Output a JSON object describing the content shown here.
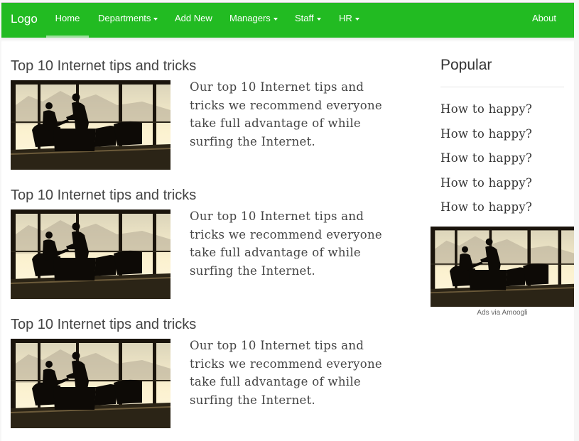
{
  "navbar": {
    "logo": "Logo",
    "items": [
      {
        "label": "Home"
      },
      {
        "label": "Departments"
      },
      {
        "label": "Add New"
      },
      {
        "label": "Managers"
      },
      {
        "label": "Staff"
      },
      {
        "label": "HR"
      }
    ],
    "about": "About",
    "color": "#22bb22"
  },
  "posts": [
    {
      "title": "Top 10 Internet tips and tricks",
      "excerpt": "Our top 10 Internet tips and tricks we recommend everyone take full advantage of while surfing the Internet."
    },
    {
      "title": "Top 10 Internet tips and tricks",
      "excerpt": "Our top 10 Internet tips and tricks we recommend everyone take full advantage of while surfing the Internet."
    },
    {
      "title": "Top 10 Internet tips and tricks",
      "excerpt": "Our top 10 Internet tips and tricks we recommend everyone take full advantage of while surfing the Internet."
    }
  ],
  "sidebar": {
    "heading": "Popular",
    "links": [
      "How to happy?",
      "How to happy?",
      "How to happy?",
      "How to happy?",
      "How to happy?"
    ],
    "ad_caption": "Ads via Amoogli"
  }
}
